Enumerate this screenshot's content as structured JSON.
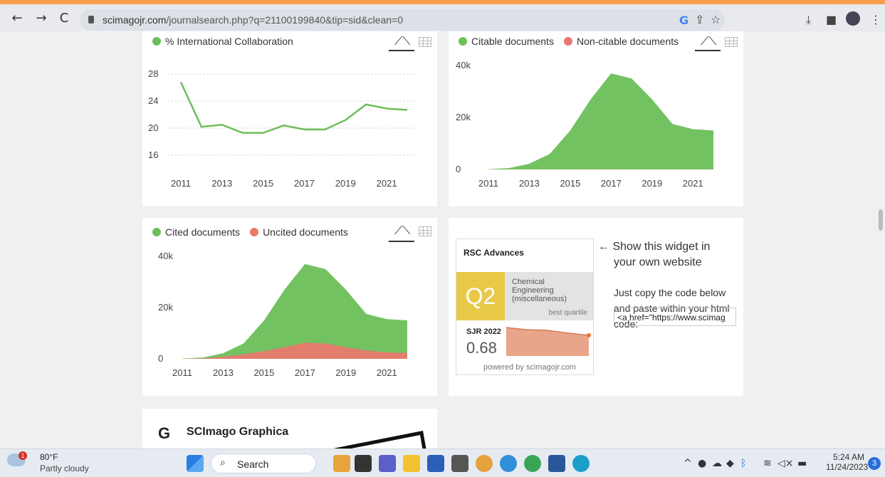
{
  "browser": {
    "url_host": "scimagojr.com",
    "url_path": "/journalsearch.php?q=21100199840&tip=sid&clean=0"
  },
  "charts": {
    "collab": {
      "legend": "% International Collaboration",
      "color": "#6cbf5a"
    },
    "citable": {
      "legend_a": "Citable documents",
      "legend_b": "Non-citable documents",
      "color_a": "#6cbf5a",
      "color_b": "#e8786e"
    },
    "cited": {
      "legend_a": "Cited documents",
      "legend_b": "Uncited documents",
      "color_a": "#6cbf5a",
      "color_b": "#e8786e"
    }
  },
  "chart_data": [
    {
      "type": "line",
      "series": [
        {
          "name": "% International Collaboration",
          "values": [
            26.8,
            20.2,
            20.5,
            19.3,
            19.3,
            20.4,
            19.8,
            19.8,
            21.2,
            23.5,
            22.9,
            22.7
          ]
        }
      ],
      "x": [
        2011,
        2012,
        2013,
        2014,
        2015,
        2016,
        2017,
        2018,
        2019,
        2020,
        2021,
        2022
      ],
      "xticks": [
        "2011",
        "2013",
        "2015",
        "2017",
        "2019",
        "2021"
      ],
      "yticks": [
        "28",
        "24",
        "20",
        "16"
      ],
      "ylim": [
        16,
        28
      ]
    },
    {
      "type": "area",
      "series": [
        {
          "name": "Citable documents",
          "values": [
            100,
            500,
            2200,
            6000,
            15000,
            27000,
            37000,
            35000,
            27000,
            17500,
            15500,
            15000
          ]
        },
        {
          "name": "Non-citable documents",
          "values": [
            0,
            0,
            20,
            40,
            50,
            60,
            60,
            50,
            40,
            30,
            30,
            30
          ]
        }
      ],
      "x": [
        2011,
        2012,
        2013,
        2014,
        2015,
        2016,
        2017,
        2018,
        2019,
        2020,
        2021,
        2022
      ],
      "xticks": [
        "2011",
        "2013",
        "2015",
        "2017",
        "2019",
        "2021"
      ],
      "yticks": [
        "40k",
        "20k",
        "0"
      ],
      "ylim": [
        0,
        40000
      ]
    },
    {
      "type": "area",
      "series": [
        {
          "name": "Cited documents",
          "values": [
            100,
            500,
            2200,
            6000,
            15000,
            27000,
            37000,
            35000,
            27000,
            17500,
            15500,
            15000
          ]
        },
        {
          "name": "Uncited documents",
          "values": [
            0,
            200,
            800,
            1800,
            3000,
            4500,
            6300,
            6000,
            4500,
            3300,
            2500,
            2300
          ]
        }
      ],
      "x": [
        2011,
        2012,
        2013,
        2014,
        2015,
        2016,
        2017,
        2018,
        2019,
        2020,
        2021,
        2022
      ],
      "xticks": [
        "2011",
        "2013",
        "2015",
        "2017",
        "2019",
        "2021"
      ],
      "yticks": [
        "40k",
        "20k",
        "0"
      ],
      "ylim": [
        0,
        40000
      ]
    }
  ],
  "widget": {
    "journal": "RSC Advances",
    "quartile": "Q2",
    "category_lines": [
      "Chemical",
      "Engineering",
      "(miscellaneous)"
    ],
    "best_quartile": "best quartile",
    "sjr_label": "SJR 2022",
    "sjr_value": "0.68",
    "powered_by": "powered by scimagojr.com",
    "show_text_1": "Show this widget in",
    "show_text_2": "your own website",
    "copy_text_1": "Just copy the code below",
    "copy_text_2": "and paste within your html",
    "copy_text_3": "code:",
    "code_value": "<a href=\"https://www.scimag"
  },
  "graphica": {
    "title": "SCImago Graphica"
  },
  "taskbar": {
    "weather_temp": "80°F",
    "weather_desc": "Partly cloudy",
    "weather_badge": "1",
    "search_label": "Search",
    "time": "5:24 AM",
    "date": "11/24/2023",
    "notification_count": "3"
  }
}
